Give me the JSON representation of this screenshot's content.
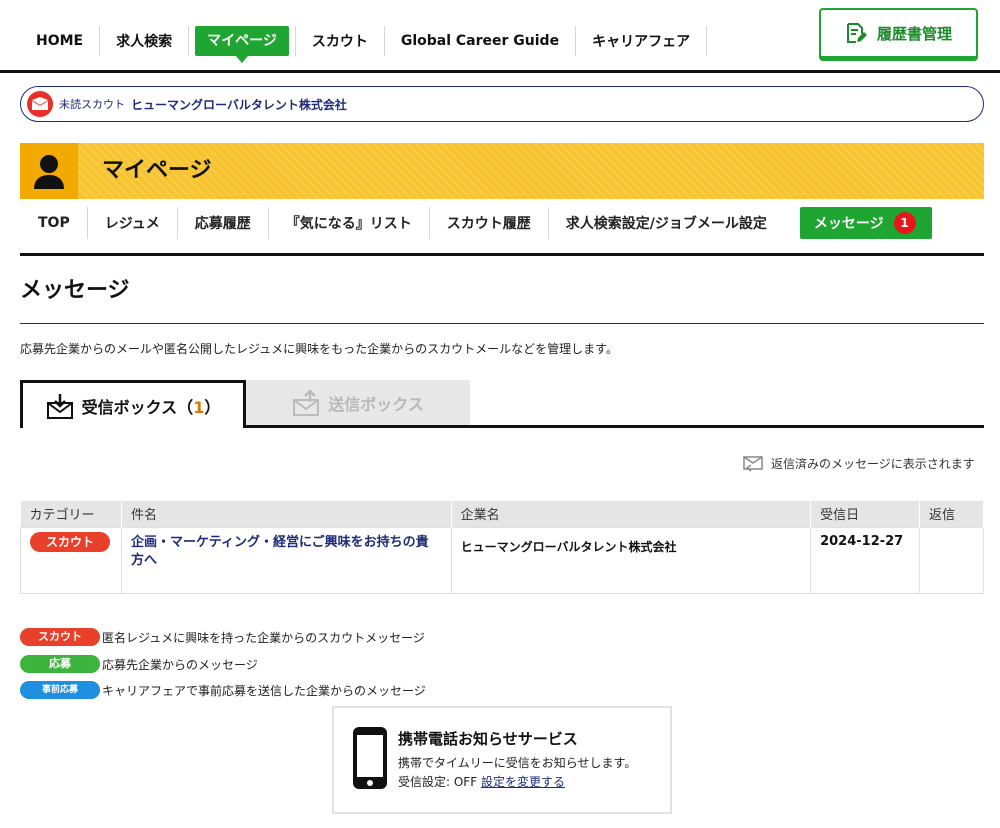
{
  "topnav": {
    "items": [
      "HOME",
      "求人検索",
      "マイページ",
      "スカウト",
      "Global Career Guide",
      "キャリアフェア"
    ],
    "active": "マイページ",
    "resume_button": "履歴書管理"
  },
  "notice": {
    "label": "未読スカウト",
    "company": "ヒューマングローバルタレント株式会社"
  },
  "banner": {
    "title": "マイページ"
  },
  "subnav": {
    "items": [
      "TOP",
      "レジュメ",
      "応募履歴",
      "『気になる』リスト",
      "スカウト履歴",
      "求人検索設定/ジョブメール設定"
    ],
    "message_label": "メッセージ",
    "message_count": "1"
  },
  "page": {
    "title": "メッセージ",
    "description": "応募先企業からのメールや匿名公開したレジュメに興味をもった企業からのスカウトメールなどを管理します。"
  },
  "tabs": {
    "inbox_label": "受信ボックス（",
    "inbox_count": "1",
    "inbox_close": "）",
    "sent_label": "送信ボックス"
  },
  "reply_note": "返信済みのメッセージに表示されます",
  "table": {
    "headers": [
      "カテゴリー",
      "件名",
      "企業名",
      "受信日",
      "返信"
    ],
    "rows": [
      {
        "category": "スカウト",
        "subject": "企画・マーケティング・経営にご興味をお持ちの貴方へ",
        "company": "ヒューマングローバルタレント株式会社",
        "date": "2024-12-27",
        "reply": ""
      }
    ]
  },
  "legend": [
    {
      "label": "スカウト",
      "text": "匿名レジュメに興味を持った企業からのスカウトメッセージ",
      "color": "#e8402a"
    },
    {
      "label": "応募",
      "text": "応募先企業からのメッセージ",
      "color": "#3cb43c"
    },
    {
      "label": "事前応募",
      "text": "キャリアフェアで事前応募を送信した企業からのメッセージ",
      "color": "#1f8fe0"
    }
  ],
  "mobile": {
    "title": "携帯電話お知らせサービス",
    "line1": "携帯でタイムリーに受信をお知らせします。",
    "status_label": "受信設定: OFF",
    "change_link": "設定を変更する"
  }
}
